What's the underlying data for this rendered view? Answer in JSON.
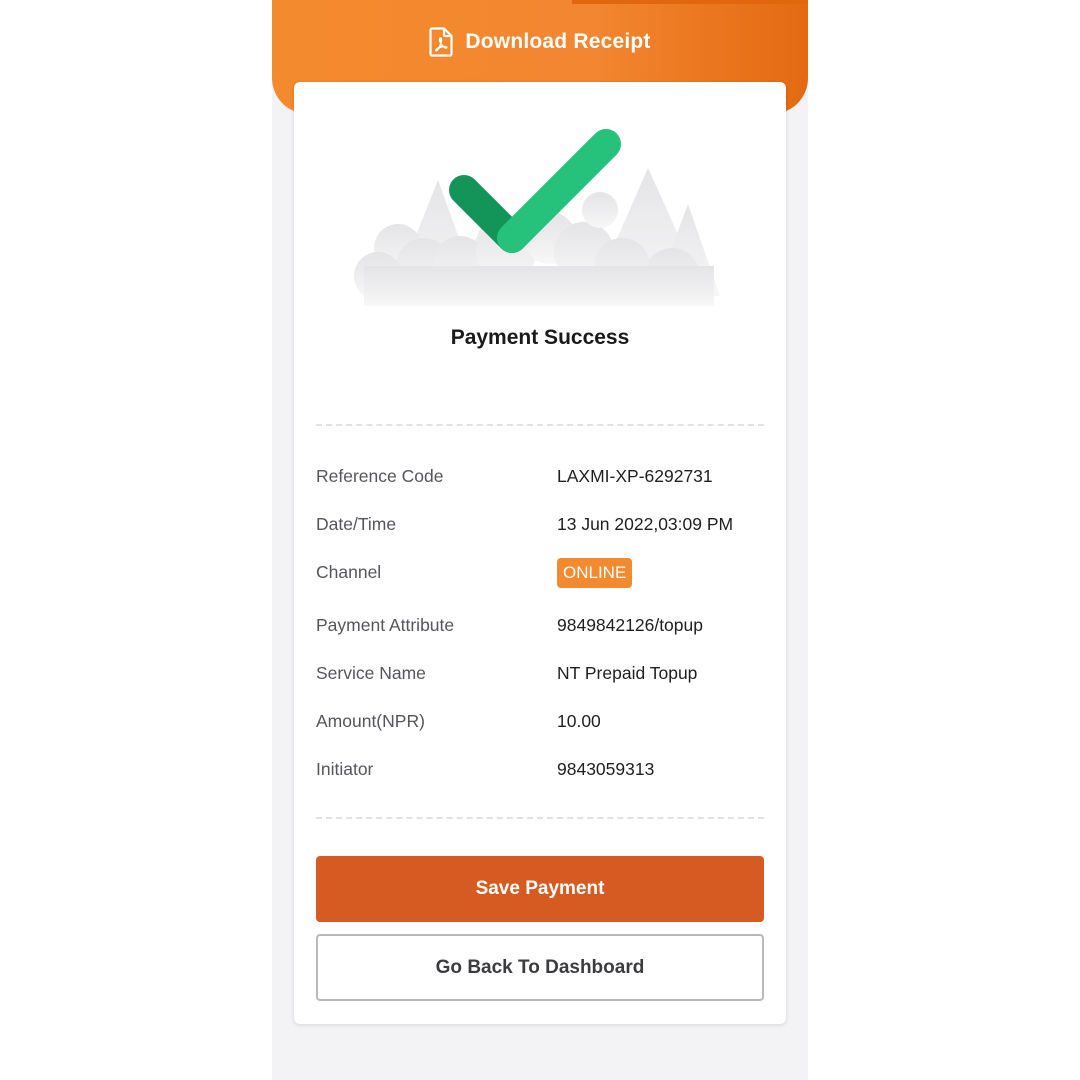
{
  "header": {
    "download_label": "Download Receipt",
    "icon": "pdf-file-icon"
  },
  "status": {
    "title": "Payment Success",
    "icon": "checkmark-icon"
  },
  "details": [
    {
      "label": "Reference Code",
      "value": "LAXMI-XP-6292731"
    },
    {
      "label": "Date/Time",
      "value": "13 Jun 2022,03:09 PM"
    },
    {
      "label": "Channel",
      "value": "ONLINE"
    },
    {
      "label": "Payment Attribute",
      "value": "9849842126/topup"
    },
    {
      "label": "Service Name",
      "value": "NT Prepaid Topup"
    },
    {
      "label": "Amount(NPR)",
      "value": "10.00"
    },
    {
      "label": "Initiator",
      "value": "9843059313"
    }
  ],
  "actions": {
    "save_label": "Save Payment",
    "back_label": "Go Back To Dashboard"
  },
  "colors": {
    "accent": "#f38630",
    "primary_button": "#d55b22",
    "success_green": "#26c17b",
    "success_green_dark": "#13955a"
  }
}
